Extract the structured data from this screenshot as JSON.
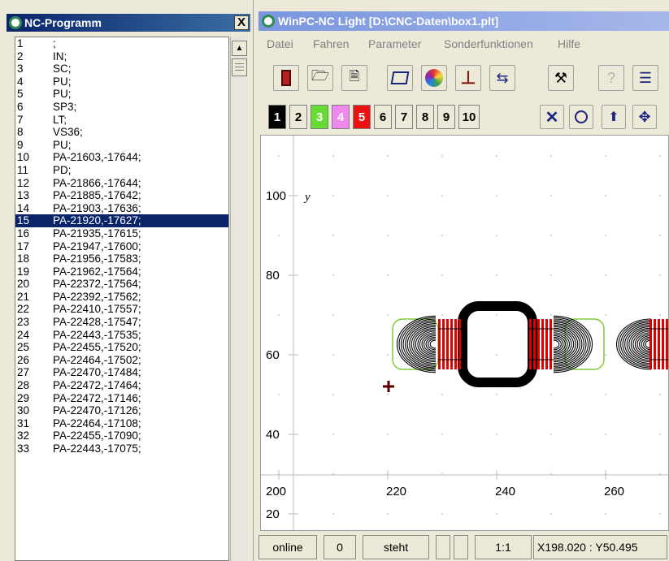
{
  "nc_window": {
    "title": "NC-Programm",
    "close_label": "X",
    "selected_line": "15",
    "lines": [
      {
        "num": "1",
        "cmd": ";"
      },
      {
        "num": "2",
        "cmd": "IN;"
      },
      {
        "num": "3",
        "cmd": "SC;"
      },
      {
        "num": "4",
        "cmd": "PU;"
      },
      {
        "num": "5",
        "cmd": "PU;"
      },
      {
        "num": "6",
        "cmd": "SP3;"
      },
      {
        "num": "7",
        "cmd": "LT;"
      },
      {
        "num": "8",
        "cmd": "VS36;"
      },
      {
        "num": "9",
        "cmd": "PU;"
      },
      {
        "num": "10",
        "cmd": "PA-21603,-17644;"
      },
      {
        "num": "11",
        "cmd": "PD;"
      },
      {
        "num": "12",
        "cmd": "PA-21866,-17644;"
      },
      {
        "num": "13",
        "cmd": "PA-21885,-17642;"
      },
      {
        "num": "14",
        "cmd": "PA-21903,-17636;"
      },
      {
        "num": "15",
        "cmd": "PA-21920,-17627;"
      },
      {
        "num": "16",
        "cmd": "PA-21935,-17615;"
      },
      {
        "num": "17",
        "cmd": "PA-21947,-17600;"
      },
      {
        "num": "18",
        "cmd": "PA-21956,-17583;"
      },
      {
        "num": "19",
        "cmd": "PA-21962,-17564;"
      },
      {
        "num": "20",
        "cmd": "PA-22372,-17564;"
      },
      {
        "num": "21",
        "cmd": "PA-22392,-17562;"
      },
      {
        "num": "22",
        "cmd": "PA-22410,-17557;"
      },
      {
        "num": "23",
        "cmd": "PA-22428,-17547;"
      },
      {
        "num": "24",
        "cmd": "PA-22443,-17535;"
      },
      {
        "num": "25",
        "cmd": "PA-22455,-17520;"
      },
      {
        "num": "26",
        "cmd": "PA-22464,-17502;"
      },
      {
        "num": "27",
        "cmd": "PA-22470,-17484;"
      },
      {
        "num": "28",
        "cmd": "PA-22472,-17464;"
      },
      {
        "num": "29",
        "cmd": "PA-22472,-17146;"
      },
      {
        "num": "30",
        "cmd": "PA-22470,-17126;"
      },
      {
        "num": "31",
        "cmd": "PA-22464,-17108;"
      },
      {
        "num": "32",
        "cmd": "PA-22455,-17090;"
      },
      {
        "num": "33",
        "cmd": "PA-22443,-17075;"
      }
    ]
  },
  "main_window": {
    "title": "WinPC-NC Light [D:\\CNC-Daten\\box1.plt]",
    "menu": [
      "Datei",
      "Fahren",
      "Parameter",
      "Sonderfunktionen",
      "Hilfe"
    ],
    "toolbar_icons": [
      "exit-door-icon",
      "open-folder-icon",
      "document-icon",
      "zoom-window-icon",
      "color-wheel-icon",
      "reference-run-icon",
      "swap-icon",
      "tools-icon",
      "probe-icon",
      "list-icon"
    ],
    "pen_buttons": [
      {
        "label": "1",
        "bg": "#000000",
        "fg": "#ffffff"
      },
      {
        "label": "2",
        "bg": "#ece9d8",
        "fg": "#000000"
      },
      {
        "label": "3",
        "bg": "#66dd33",
        "fg": "#ffffff"
      },
      {
        "label": "4",
        "bg": "#ee88ee",
        "fg": "#ffffff"
      },
      {
        "label": "5",
        "bg": "#ee1111",
        "fg": "#ffffff"
      },
      {
        "label": "6",
        "bg": "#ece9d8",
        "fg": "#000000"
      },
      {
        "label": "7",
        "bg": "#ece9d8",
        "fg": "#000000"
      },
      {
        "label": "8",
        "bg": "#ece9d8",
        "fg": "#000000"
      },
      {
        "label": "9",
        "bg": "#ece9d8",
        "fg": "#000000"
      },
      {
        "label": "10",
        "bg": "#ece9d8",
        "fg": "#000000"
      }
    ],
    "view_icons": [
      "clear-x-icon",
      "zoom-icon",
      "home-up-icon",
      "move-arrows-icon"
    ],
    "canvas": {
      "y_axis_label": "y",
      "y_ticks": [
        "100",
        "80",
        "60",
        "40",
        "20"
      ],
      "x_ticks": [
        "200",
        "220",
        "240",
        "260"
      ]
    },
    "status": {
      "connection": "online",
      "count": "0",
      "state": "steht",
      "scale": "1:1",
      "position": "X198.020 : Y50.495"
    }
  }
}
